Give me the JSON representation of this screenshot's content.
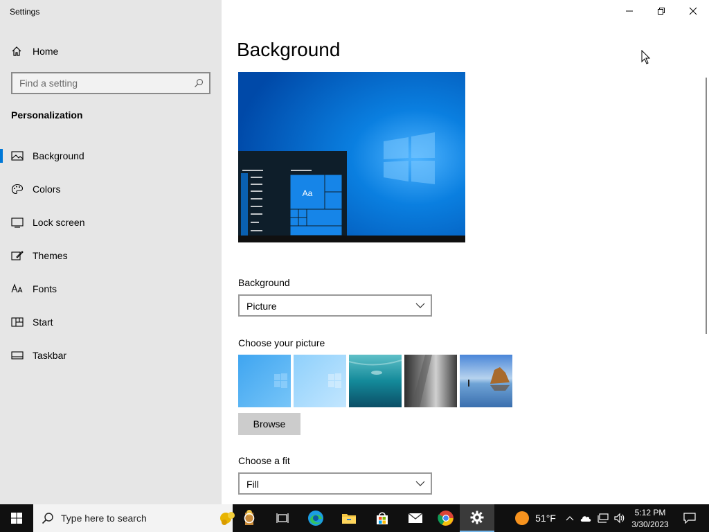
{
  "window": {
    "title": "Settings"
  },
  "sidebar": {
    "home_label": "Home",
    "search_placeholder": "Find a setting",
    "section_title": "Personalization",
    "items": [
      {
        "label": "Background",
        "icon": "picture-icon",
        "active": true
      },
      {
        "label": "Colors",
        "icon": "palette-icon",
        "active": false
      },
      {
        "label": "Lock screen",
        "icon": "lock-screen-icon",
        "active": false
      },
      {
        "label": "Themes",
        "icon": "themes-icon",
        "active": false
      },
      {
        "label": "Fonts",
        "icon": "fonts-icon",
        "active": false
      },
      {
        "label": "Start",
        "icon": "start-icon",
        "active": false
      },
      {
        "label": "Taskbar",
        "icon": "taskbar-icon",
        "active": false
      }
    ]
  },
  "main": {
    "title": "Background",
    "preview_tile_text": "Aa",
    "background_label": "Background",
    "background_value": "Picture",
    "choose_picture_label": "Choose your picture",
    "browse_label": "Browse",
    "fit_label": "Choose a fit",
    "fit_value": "Fill"
  },
  "taskbar": {
    "search_placeholder": "Type here to search",
    "weather_temp": "51°F",
    "time": "5:12 PM",
    "date": "3/30/2023"
  },
  "colors": {
    "accent": "#0078d7",
    "sidebar_bg": "#e6e6e6",
    "taskbar_bg": "#101010"
  }
}
